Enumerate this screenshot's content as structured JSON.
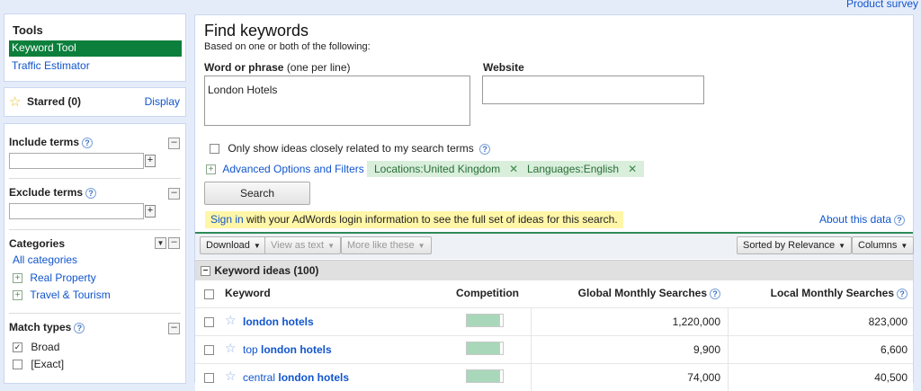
{
  "top_link": "Product survey",
  "tools": {
    "title": "Tools",
    "items": [
      "Keyword Tool",
      "Traffic Estimator"
    ]
  },
  "starred": {
    "label": "Starred (0)",
    "display": "Display"
  },
  "include_terms": {
    "label": "Include terms",
    "help": "?",
    "add": "+"
  },
  "exclude_terms": {
    "label": "Exclude terms",
    "help": "?",
    "add": "+"
  },
  "categories": {
    "label": "Categories",
    "all": "All categories",
    "items": [
      "Real Property",
      "Travel & Tourism"
    ]
  },
  "match_types": {
    "label": "Match types",
    "help": "?",
    "options": [
      {
        "label": "Broad",
        "checked": true
      },
      {
        "label": "[Exact]",
        "checked": false
      }
    ]
  },
  "find": {
    "title": "Find keywords",
    "subtitle": "Based on one or both of the following:",
    "word_label": "Word or phrase",
    "word_hint": "(one per line)",
    "word_value": "London Hotels",
    "website_label": "Website",
    "website_value": "",
    "only_show": "Only show ideas closely related to my search terms",
    "advanced": "Advanced Options and Filters",
    "chips": [
      "Locations:United Kingdom",
      "Languages:English"
    ],
    "search_button": "Search",
    "sign_in": "Sign in",
    "sign_in_rest": " with your AdWords login information to see the full set of ideas for this search.",
    "about": "About this data"
  },
  "toolbar": {
    "download": "Download",
    "view_as_text": "View as text",
    "more_like_these": "More like these",
    "sorted": "Sorted by Relevance",
    "columns": "Columns"
  },
  "ideas": {
    "header": "Keyword ideas (100)",
    "columns": [
      "Keyword",
      "Competition",
      "Global Monthly Searches",
      "Local Monthly Searches"
    ],
    "rows": [
      {
        "prefix": "",
        "keyword": "london hotels",
        "competition": 0.92,
        "global": "1,220,000",
        "local": "823,000"
      },
      {
        "prefix": "top ",
        "keyword": "london hotels",
        "competition": 0.93,
        "global": "9,900",
        "local": "6,600"
      },
      {
        "prefix": "central ",
        "keyword": "london hotels",
        "competition": 0.93,
        "global": "74,000",
        "local": "40,500"
      }
    ]
  }
}
